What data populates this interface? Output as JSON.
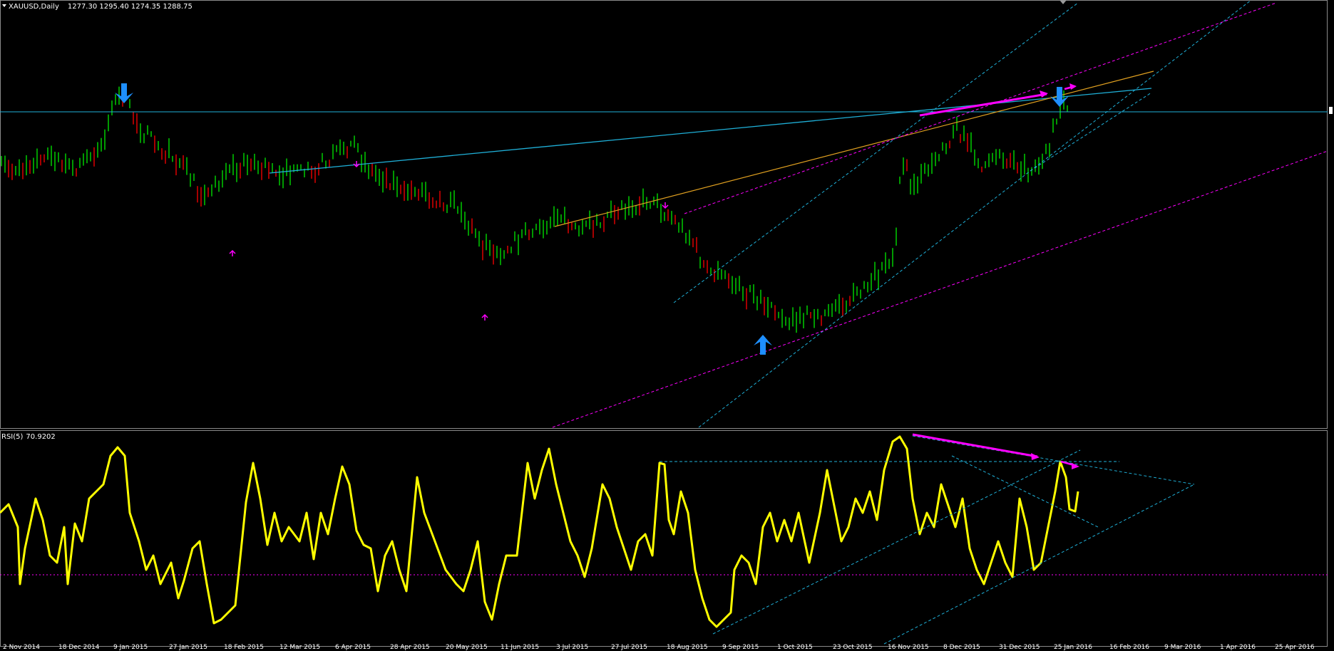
{
  "header": {
    "symbol": "XAUUSD,Daily",
    "ohlc": "1277.30 1295.40 1274.35 1288.75"
  },
  "indicator": {
    "name": "RSI(5)",
    "value": "70.9202"
  },
  "time_axis": {
    "labels": [
      "2 Nov 2014",
      "18 Dec 2014",
      "9 Jan 2015",
      "27 Jan 2015",
      "18 Feb 2015",
      "12 Mar 2015",
      "6 Apr 2015",
      "28 Apr 2015",
      "20 May 2015",
      "11 Jun 2015",
      "3 Jul 2015",
      "27 Jul 2015",
      "18 Aug 2015",
      "9 Sep 2015",
      "1 Oct 2015",
      "23 Oct 2015",
      "16 Nov 2015",
      "8 Dec 2015",
      "31 Dec 2015",
      "25 Jan 2016",
      "16 Feb 2016",
      "9 Mar 2016",
      "1 Apr 2016",
      "25 Apr 2016"
    ]
  },
  "colors": {
    "background": "#000000",
    "bull_bar": "#00c000",
    "bear_bar": "#d00000",
    "rsi_line": "#ffff00",
    "trend_cyan": "#1fb0d8",
    "trend_orange": "#e0a020",
    "trend_magenta": "#ff00ff",
    "signal_blue": "#1e8fff"
  },
  "icons": {
    "sell_signal": "arrow-down-icon",
    "buy_signal": "arrow-up-icon"
  }
}
